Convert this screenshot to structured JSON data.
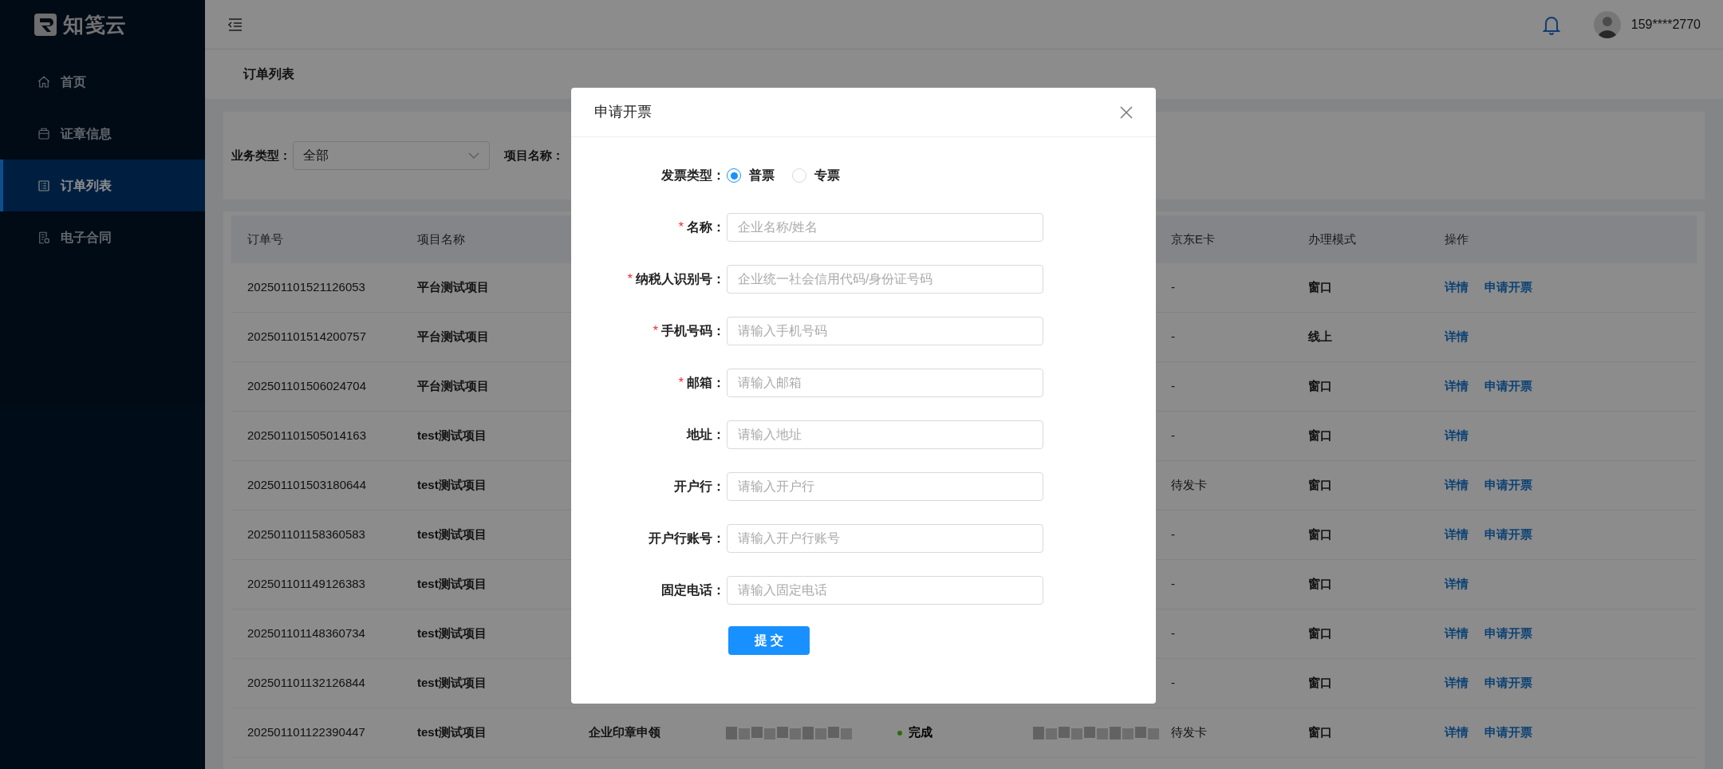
{
  "sidebar": {
    "brand": "知笺云",
    "items": [
      {
        "label": "首页",
        "selected": false
      },
      {
        "label": "证章信息",
        "selected": false
      },
      {
        "label": "订单列表",
        "selected": true
      },
      {
        "label": "电子合同",
        "selected": false
      }
    ]
  },
  "header": {
    "user": "159****2770"
  },
  "breadcrumb": "订单列表",
  "filters": [
    {
      "label": "业务类型：",
      "kind": "select",
      "value": "全部"
    },
    {
      "label": "项目名称：",
      "kind": "label"
    }
  ],
  "table": {
    "columns": [
      "订单号",
      "项目名称",
      null,
      null,
      null,
      null,
      "京东E卡",
      "办理模式",
      "操作"
    ],
    "rows": [
      {
        "cells": [
          "202501101521126053",
          "平台测试项目",
          null,
          null,
          null,
          null,
          "-",
          "窗口",
          [
            "详情",
            "申请开票"
          ]
        ]
      },
      {
        "cells": [
          "202501101514200757",
          "平台测试项目",
          null,
          null,
          null,
          null,
          "-",
          "线上",
          [
            "详情"
          ]
        ]
      },
      {
        "cells": [
          "202501101506024704",
          "平台测试项目",
          null,
          null,
          null,
          null,
          "-",
          "窗口",
          [
            "详情",
            "申请开票"
          ]
        ]
      },
      {
        "cells": [
          "202501101505014163",
          "test测试项目",
          null,
          null,
          null,
          null,
          "-",
          "窗口",
          [
            "详情"
          ]
        ]
      },
      {
        "cells": [
          "202501101503180644",
          "test测试项目",
          null,
          null,
          null,
          null,
          "待发卡",
          "窗口",
          [
            "详情",
            "申请开票"
          ]
        ]
      },
      {
        "cells": [
          "202501101158360583",
          "test测试项目",
          null,
          null,
          null,
          null,
          "-",
          "窗口",
          [
            "详情",
            "申请开票"
          ]
        ]
      },
      {
        "cells": [
          "202501101149126383",
          "test测试项目",
          null,
          null,
          null,
          null,
          "-",
          "窗口",
          [
            "详情"
          ]
        ]
      },
      {
        "cells": [
          "202501101148360734",
          "test测试项目",
          null,
          null,
          null,
          null,
          "-",
          "窗口",
          [
            "详情",
            "申请开票"
          ]
        ]
      },
      {
        "cells": [
          "202501101132126844",
          "test测试项目",
          null,
          null,
          null,
          null,
          "-",
          "窗口",
          [
            "详情",
            "申请开票"
          ]
        ]
      },
      {
        "cells": [
          "202501101122390447",
          "test测试项目",
          "企业印章申领",
          {
            "kind": "blurred"
          },
          {
            "kind": "status",
            "text": "完成",
            "color": "#2d6c0e"
          },
          {
            "kind": "blurred"
          },
          "待发卡",
          "窗口",
          [
            "详情",
            "申请开票"
          ]
        ]
      }
    ]
  },
  "dialog": {
    "title": "申请开票",
    "type_label": "发票类型：",
    "type_options": [
      {
        "label": "普票",
        "selected": true
      },
      {
        "label": "专票",
        "selected": false
      }
    ],
    "required_mark": "*",
    "fields": [
      {
        "label": "名称：",
        "required": true,
        "placeholder": "企业名称/姓名"
      },
      {
        "label": "纳税人识别号：",
        "required": true,
        "placeholder": "企业统一社会信用代码/身份证号码"
      },
      {
        "label": "手机号码：",
        "required": true,
        "placeholder": "请输入手机号码"
      },
      {
        "label": "邮箱：",
        "required": true,
        "placeholder": "请输入邮箱"
      },
      {
        "label": "地址：",
        "required": false,
        "placeholder": "请输入地址"
      },
      {
        "label": "开户行：",
        "required": false,
        "placeholder": "请输入开户行"
      },
      {
        "label": "开户行账号：",
        "required": false,
        "placeholder": "请输入开户行账号"
      },
      {
        "label": "固定电话：",
        "required": false,
        "placeholder": "请输入固定电话"
      }
    ],
    "submit": "提 交"
  }
}
